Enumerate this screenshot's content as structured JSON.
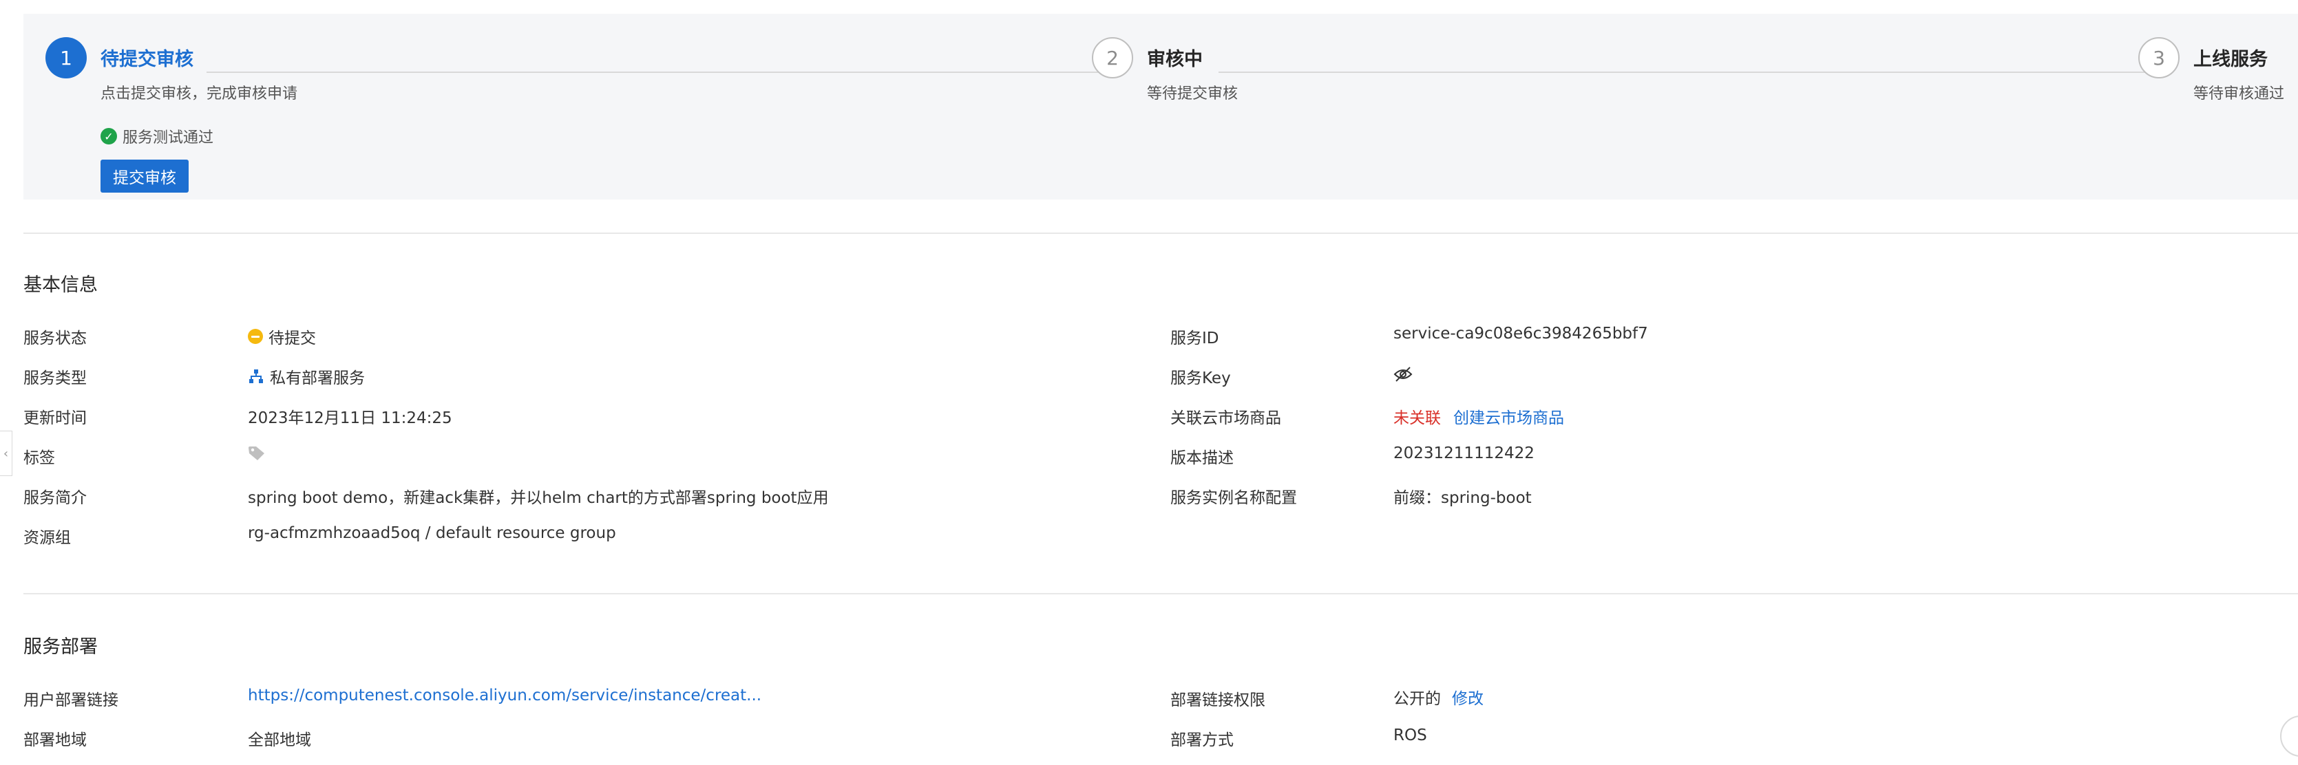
{
  "steps": [
    {
      "number": "1",
      "title": "待提交审核",
      "desc": "点击提交审核，完成审核申请",
      "status_text": "服务测试通过",
      "button": "提交审核"
    },
    {
      "number": "2",
      "title": "审核中",
      "desc": "等待提交审核"
    },
    {
      "number": "3",
      "title": "上线服务",
      "desc": "等待审核通过"
    }
  ],
  "colors": {
    "accent": "#1d6fd1",
    "success": "#1fa34a",
    "warning": "#f5b90f",
    "danger": "#d9312a"
  },
  "basic_info": {
    "title": "基本信息",
    "left": [
      {
        "label": "服务状态",
        "value": "待提交",
        "icon": "pending-status-icon"
      },
      {
        "label": "服务类型",
        "value": "私有部署服务",
        "icon": "org-tree-icon"
      },
      {
        "label": "更新时间",
        "value": "2023年12月11日 11:24:25"
      },
      {
        "label": "标签",
        "value": "",
        "icon": "tag-icon"
      },
      {
        "label": "服务简介",
        "value": "spring boot demo，新建ack集群，并以helm chart的方式部署spring boot应用"
      },
      {
        "label": "资源组",
        "value": "rg-acfmzmhzoaad5oq / default resource group"
      }
    ],
    "right": [
      {
        "label": "服务ID",
        "value": "service-ca9c08e6c3984265bbf7"
      },
      {
        "label": "服务Key",
        "value": "",
        "icon": "eye-hidden-icon"
      },
      {
        "label": "关联云市场商品",
        "value": "未关联",
        "link": "创建云市场商品"
      },
      {
        "label": "版本描述",
        "value": "20231211112422"
      },
      {
        "label": "服务实例名称配置",
        "value": "前缀：spring-boot"
      }
    ]
  },
  "deploy": {
    "title": "服务部署",
    "left": [
      {
        "label": "用户部署链接",
        "value": "https://computenest.console.aliyun.com/service/instance/creat..."
      },
      {
        "label": "部署地域",
        "value": "全部地域"
      }
    ],
    "right": [
      {
        "label": "部署链接权限",
        "value": "公开的",
        "link": "修改"
      },
      {
        "label": "部署方式",
        "value": "ROS"
      }
    ]
  }
}
